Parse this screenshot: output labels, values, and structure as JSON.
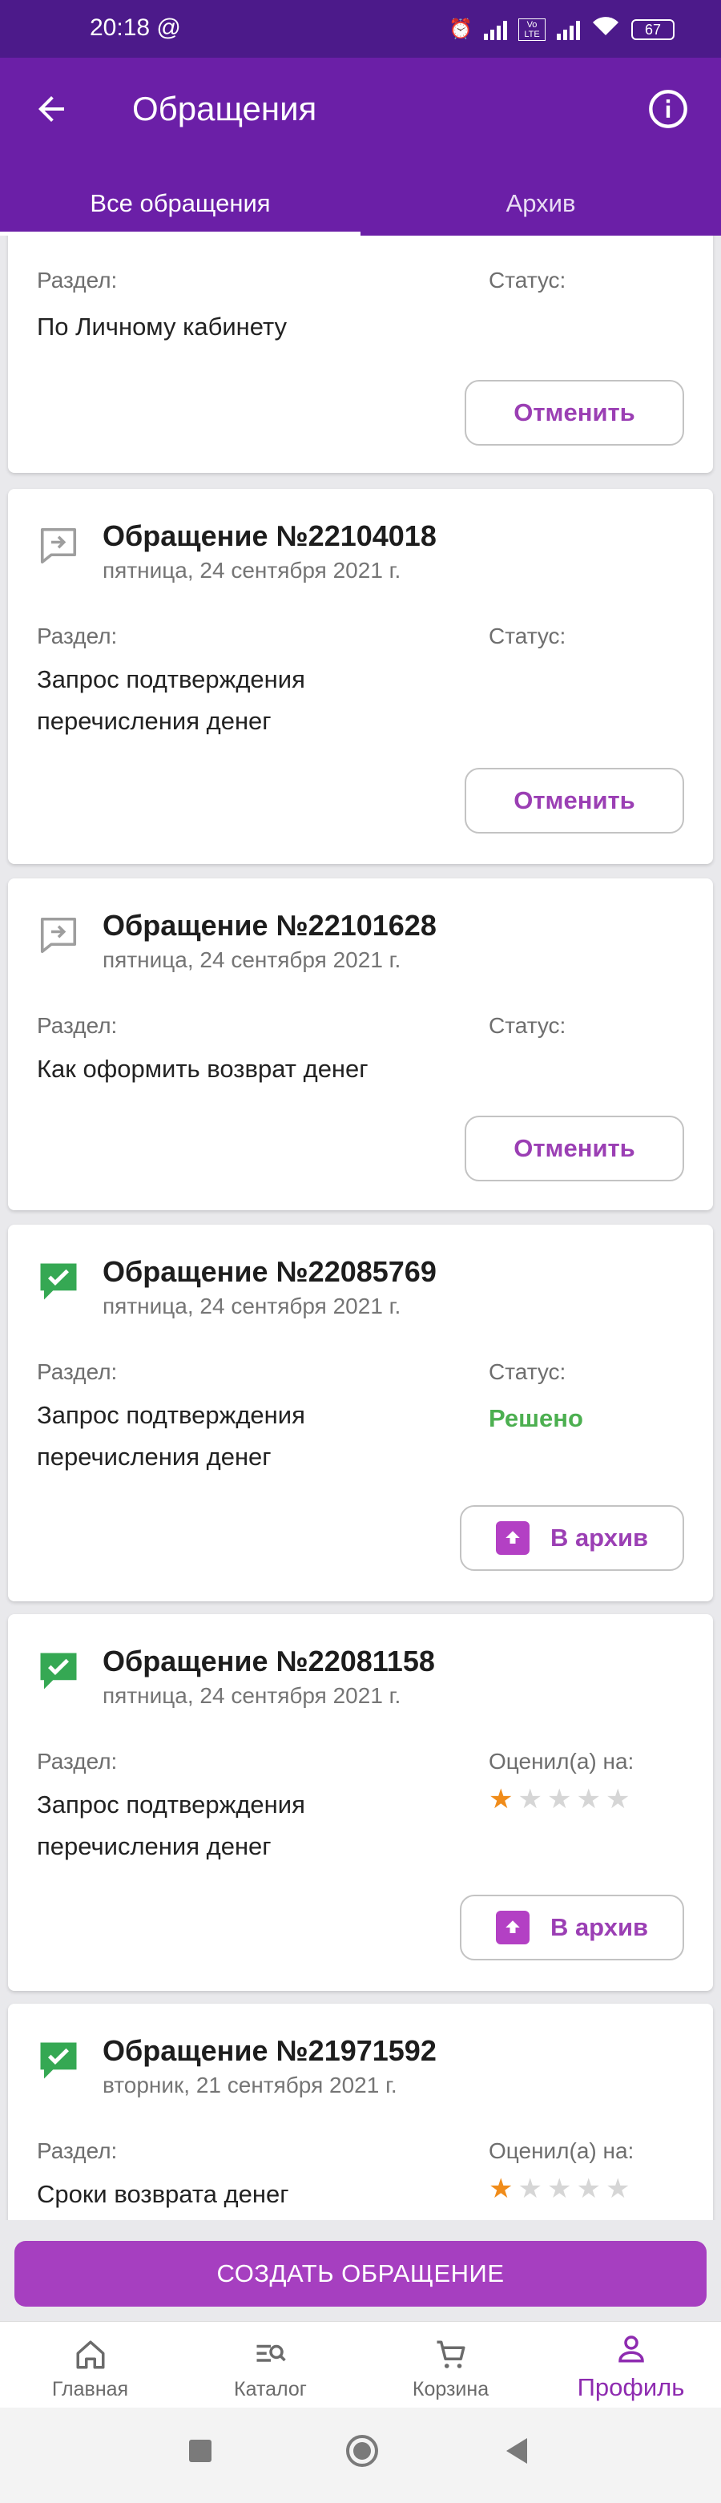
{
  "status_bar": {
    "time": "20:18",
    "at": "@",
    "lte": "Vo LTE",
    "battery": "67"
  },
  "app_bar": {
    "title": "Обращения"
  },
  "tabs": [
    {
      "label": "Все обращения"
    },
    {
      "label": "Архив"
    }
  ],
  "labels": {
    "section": "Раздел:",
    "status": "Статус:",
    "rated": "Оценил(а) на:"
  },
  "buttons": {
    "cancel": "Отменить",
    "archive": "В архив"
  },
  "cards": [
    {
      "section_value": "По Личному кабинету"
    },
    {
      "number": "Обращение №22104018",
      "date": "пятница, 24 сентября 2021 г.",
      "section_value": "Запрос подтверждения перечисления денег"
    },
    {
      "number": "Обращение №22101628",
      "date": "пятница, 24 сентября 2021 г.",
      "section_value": "Как оформить возврат денег"
    },
    {
      "number": "Обращение №22085769",
      "date": "пятница, 24 сентября 2021 г.",
      "section_value": "Запрос подтверждения перечисления денег",
      "status_value": "Решено"
    },
    {
      "number": "Обращение №22081158",
      "date": "пятница, 24 сентября 2021 г.",
      "section_value": "Запрос подтверждения перечисления денег",
      "rating": 1,
      "rating_max": 5
    },
    {
      "number": "Обращение №21971592",
      "date": "вторник, 21 сентября 2021 г.",
      "section_value": "Сроки возврата денег",
      "rating": 1,
      "rating_max": 5
    }
  ],
  "create_button": "СОЗДАТЬ ОБРАЩЕНИЕ",
  "bottom_nav": [
    {
      "label": "Главная"
    },
    {
      "label": "Каталог"
    },
    {
      "label": "Корзина"
    },
    {
      "label": "Профиль",
      "active": true
    }
  ],
  "colors": {
    "primary": "#6b1fa7",
    "accent": "#a63fc0",
    "resolved": "#4caf50",
    "star": "#f08c1a",
    "resolved_icon": "#35a853"
  }
}
